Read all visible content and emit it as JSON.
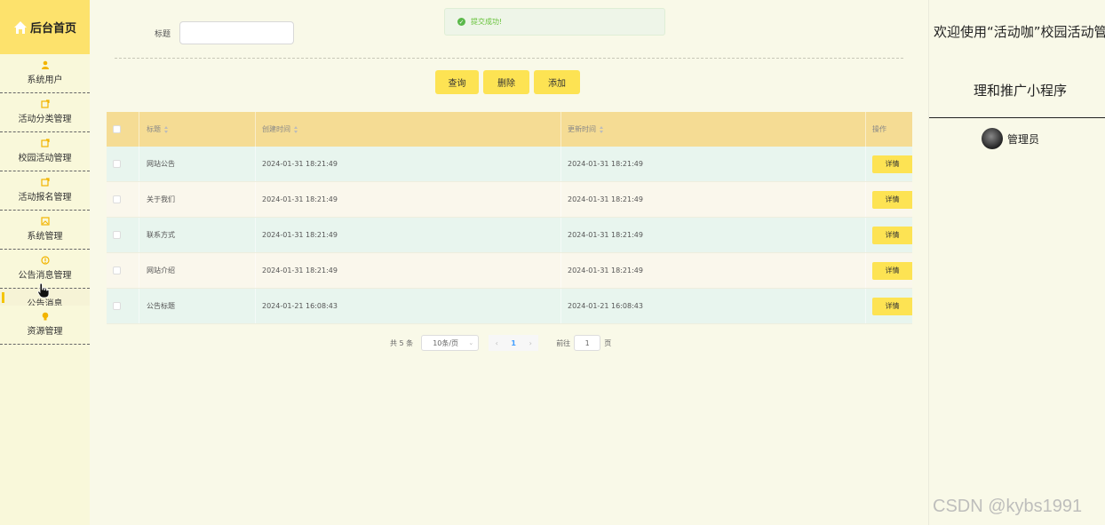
{
  "sidebar": {
    "brand": "后台首页",
    "items": [
      {
        "label": "系统用户",
        "icon": "user-icon"
      },
      {
        "label": "活动分类管理",
        "icon": "edit-icon"
      },
      {
        "label": "校园活动管理",
        "icon": "edit-icon"
      },
      {
        "label": "活动报名管理",
        "icon": "edit-icon"
      },
      {
        "label": "系统管理",
        "icon": "image-icon"
      },
      {
        "label": "公告消息管理",
        "icon": "info-icon"
      }
    ],
    "sub_item": "公告消息",
    "last_item": {
      "label": "资源管理",
      "icon": "bulb-icon"
    }
  },
  "search": {
    "label": "标题",
    "value": "",
    "placeholder": ""
  },
  "toast": {
    "message": "提交成功!"
  },
  "buttons": {
    "query": "查询",
    "delete": "删除",
    "add": "添加"
  },
  "table": {
    "headers": [
      "标题",
      "创建时间",
      "更新时间",
      "操作"
    ],
    "rows": [
      {
        "title": "网站公告",
        "created": "2024-01-31 18:21:49",
        "updated": "2024-01-31 18:21:49",
        "action": "详情"
      },
      {
        "title": "关于我们",
        "created": "2024-01-31 18:21:49",
        "updated": "2024-01-31 18:21:49",
        "action": "详情"
      },
      {
        "title": "联系方式",
        "created": "2024-01-31 18:21:49",
        "updated": "2024-01-31 18:21:49",
        "action": "详情"
      },
      {
        "title": "网站介绍",
        "created": "2024-01-31 18:21:49",
        "updated": "2024-01-31 18:21:49",
        "action": "详情"
      },
      {
        "title": "公告标题",
        "created": "2024-01-21 16:08:43",
        "updated": "2024-01-21 16:08:43",
        "action": "详情"
      }
    ]
  },
  "pagination": {
    "total": "共 5 条",
    "page_size": "10条/页",
    "current_page": "1",
    "goto_label": "前往",
    "goto_value": "1",
    "page_suffix": "页"
  },
  "header_right": {
    "welcome_line1": "欢迎使用“活动咖”校园活动管",
    "welcome_line2": "理和推广小程序",
    "user_name": "管理员"
  },
  "watermark": "CSDN @kybs1991",
  "colors": {
    "accent": "#fde353",
    "brand_bg": "#fde26c",
    "header_bg": "#f5dc94",
    "row_even": "#e8f5ee",
    "row_odd": "#faf7ec",
    "success": "#67c23a"
  }
}
